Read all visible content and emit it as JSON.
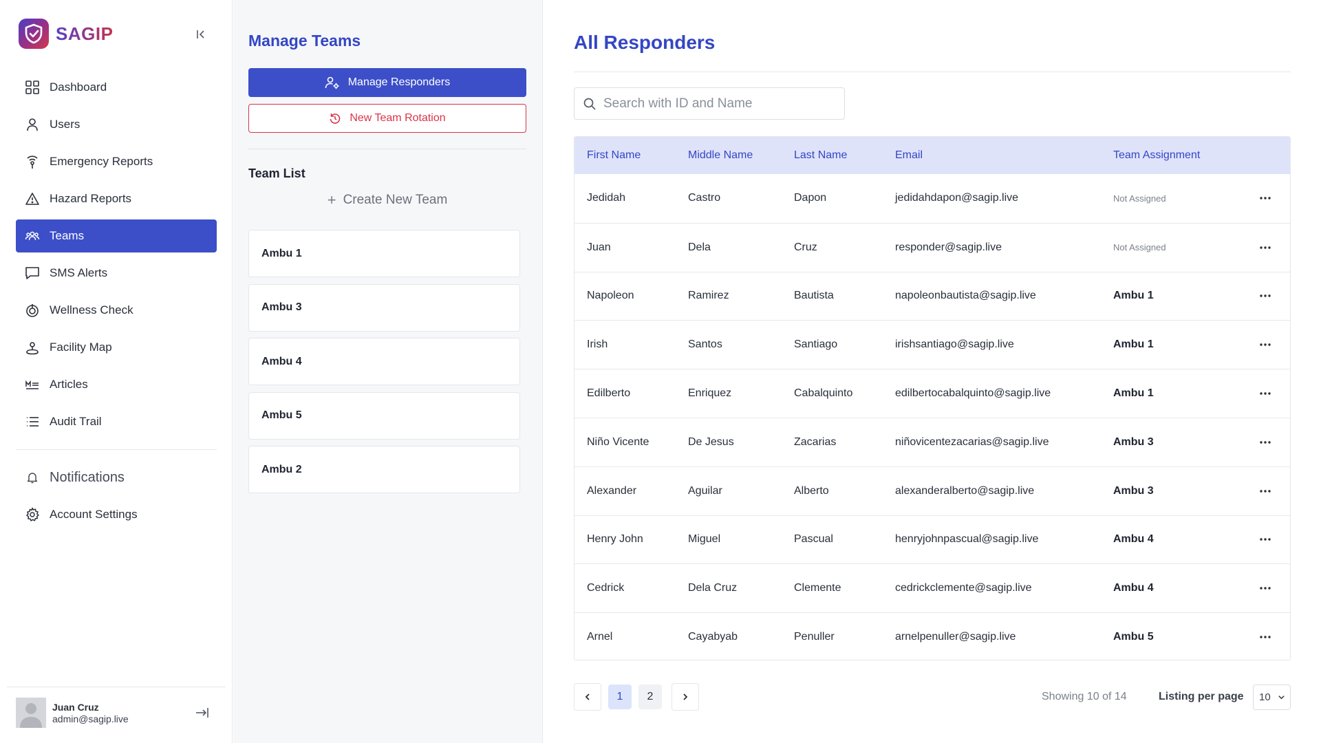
{
  "brand": {
    "name": "SAGIP"
  },
  "sidebar": {
    "items": [
      {
        "label": "Dashboard",
        "icon": "dashboard-icon"
      },
      {
        "label": "Users",
        "icon": "user-icon"
      },
      {
        "label": "Emergency Reports",
        "icon": "emergency-signal-icon"
      },
      {
        "label": "Hazard Reports",
        "icon": "warning-triangle-icon"
      },
      {
        "label": "Teams",
        "icon": "team-icon",
        "active": true
      },
      {
        "label": "SMS Alerts",
        "icon": "message-icon"
      },
      {
        "label": "Wellness Check",
        "icon": "wellness-icon"
      },
      {
        "label": "Facility Map",
        "icon": "map-pin-icon"
      },
      {
        "label": "Articles",
        "icon": "articles-icon"
      },
      {
        "label": "Audit Trail",
        "icon": "list-icon"
      }
    ],
    "notifications_label": "Notifications",
    "account_settings_label": "Account Settings"
  },
  "user": {
    "name": "Juan Cruz",
    "email": "admin@sagip.live"
  },
  "teams_panel": {
    "title": "Manage Teams",
    "manage_responders_label": "Manage Responders",
    "new_rotation_label": "New Team Rotation",
    "team_list_label": "Team List",
    "create_team_label": "Create New Team",
    "teams": [
      "Ambu 1",
      "Ambu 3",
      "Ambu 4",
      "Ambu 5",
      "Ambu 2"
    ]
  },
  "main": {
    "title": "All Responders",
    "search": {
      "placeholder": "Search with ID and Name",
      "value": ""
    },
    "columns": [
      "First Name",
      "Middle Name",
      "Last Name",
      "Email",
      "Team Assignment"
    ],
    "rows": [
      {
        "first": "Jedidah",
        "middle": "Castro",
        "last": "Dapon",
        "email": "jedidahdapon@sagip.live",
        "team": "Not Assigned",
        "assigned": false
      },
      {
        "first": "Juan",
        "middle": "Dela",
        "last": "Cruz",
        "email": "responder@sagip.live",
        "team": "Not Assigned",
        "assigned": false
      },
      {
        "first": "Napoleon",
        "middle": "Ramirez",
        "last": "Bautista",
        "email": "napoleonbautista@sagip.live",
        "team": "Ambu 1",
        "assigned": true
      },
      {
        "first": "Irish",
        "middle": "Santos",
        "last": "Santiago",
        "email": "irishsantiago@sagip.live",
        "team": "Ambu 1",
        "assigned": true
      },
      {
        "first": "Edilberto",
        "middle": "Enriquez",
        "last": "Cabalquinto",
        "email": "edilbertocabalquinto@sagip.live",
        "team": "Ambu 1",
        "assigned": true
      },
      {
        "first": "Niño Vicente",
        "middle": "De Jesus",
        "last": "Zacarias",
        "email": "niñovicentezacarias@sagip.live",
        "team": "Ambu 3",
        "assigned": true
      },
      {
        "first": "Alexander",
        "middle": "Aguilar",
        "last": "Alberto",
        "email": "alexanderalberto@sagip.live",
        "team": "Ambu 3",
        "assigned": true
      },
      {
        "first": "Henry John",
        "middle": "Miguel",
        "last": "Pascual",
        "email": "henryjohnpascual@sagip.live",
        "team": "Ambu 4",
        "assigned": true
      },
      {
        "first": "Cedrick",
        "middle": "Dela Cruz",
        "last": "Clemente",
        "email": "cedrickclemente@sagip.live",
        "team": "Ambu 4",
        "assigned": true
      },
      {
        "first": "Arnel",
        "middle": "Cayabyab",
        "last": "Penuller",
        "email": "arnelpenuller@sagip.live",
        "team": "Ambu 5",
        "assigned": true
      }
    ],
    "pagination": {
      "pages": [
        "1",
        "2"
      ],
      "current": "1",
      "showing": "Showing 10 of 14",
      "per_page_label": "Listing per page",
      "per_page_value": "10"
    }
  },
  "colors": {
    "primary": "#3c4fc9",
    "danger": "#d8334a",
    "header_bg": "#dfe3fa"
  }
}
